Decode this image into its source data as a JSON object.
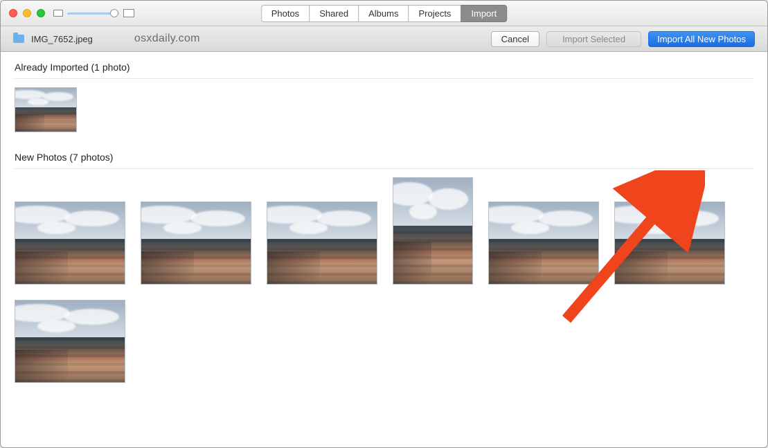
{
  "tabs": [
    "Photos",
    "Shared",
    "Albums",
    "Projects",
    "Import"
  ],
  "active_tab": "Import",
  "toolbar": {
    "filename": "IMG_7652.jpeg",
    "watermark": "osxdaily.com",
    "cancel_label": "Cancel",
    "import_selected_label": "Import Selected",
    "import_all_label": "Import All New Photos"
  },
  "sections": {
    "already_imported": {
      "heading": "Already Imported (1 photo)",
      "count": 1
    },
    "new_photos": {
      "heading": "New Photos (7 photos)",
      "count": 7
    }
  },
  "slider": {
    "min": 0,
    "max": 1,
    "value": 0.85
  }
}
